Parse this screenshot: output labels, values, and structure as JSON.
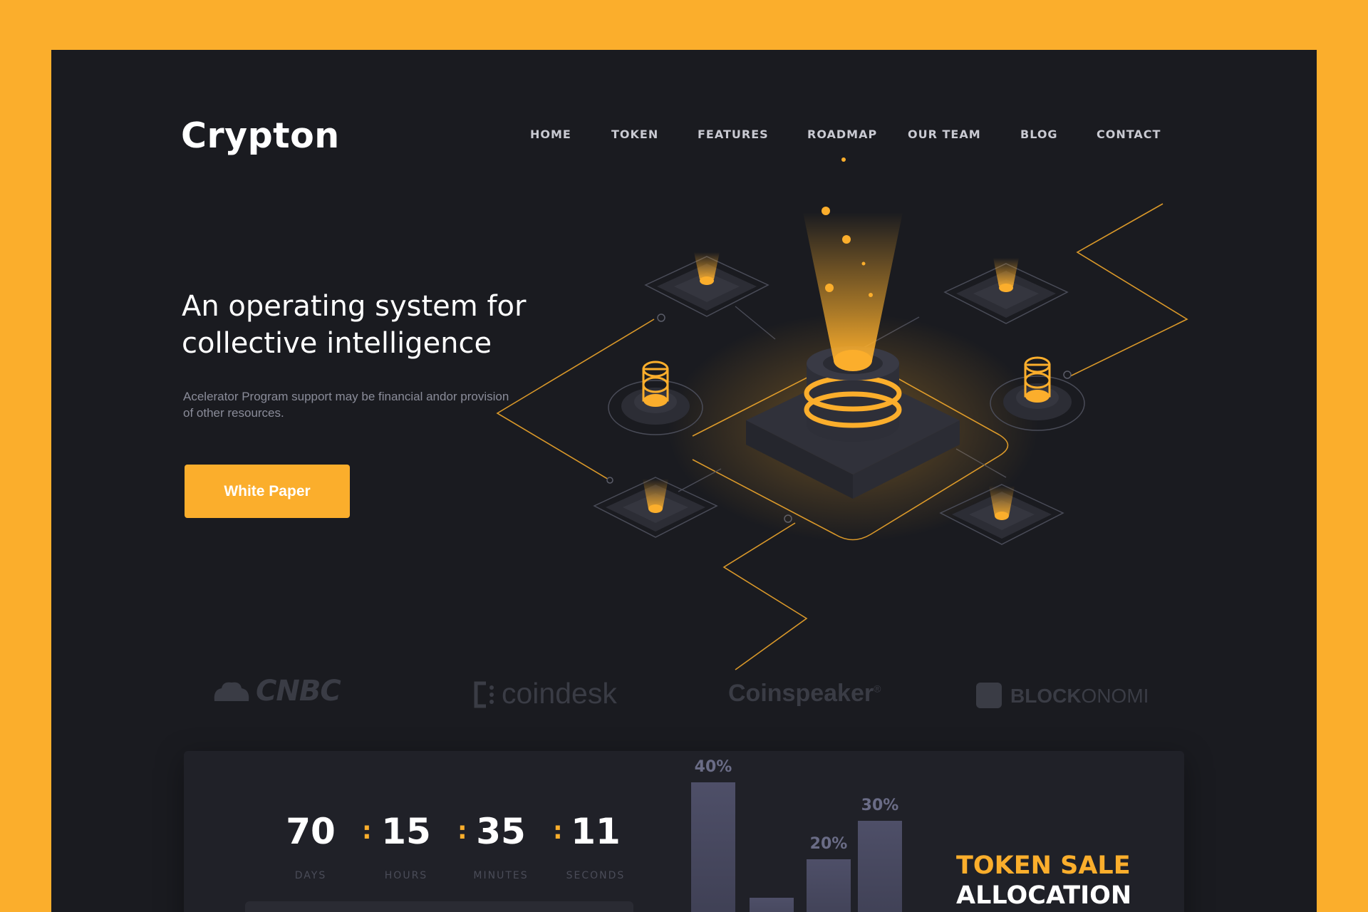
{
  "brand": {
    "name": "Crypton"
  },
  "nav": {
    "items": [
      "HOME",
      "TOKEN",
      "FEATURES",
      "ROADMAP",
      "OUR TEAM",
      "BLOG",
      "CONTACT"
    ],
    "active": "ROADMAP"
  },
  "hero": {
    "headline_line1": "An operating system for",
    "headline_line2": "collective intelligence",
    "subtext": "Acelerator Program support may be financial andor provision of other resources.",
    "cta_label": "White Paper"
  },
  "partners": {
    "cnbc": "CNBC",
    "coindesk": "coindesk",
    "coinspeaker": "Coinspeaker",
    "coinspeaker_mark": "®",
    "blockonomi_bold": "BLOCK",
    "blockonomi_thin": "ONOMI"
  },
  "countdown": {
    "days": "70",
    "hours": "15",
    "minutes": "35",
    "seconds": "11",
    "separator": ":",
    "days_label": "DAYS",
    "hours_label": "HOURS",
    "minutes_label": "MINUTES",
    "seconds_label": "SECONDS"
  },
  "token_sale": {
    "title_line1": "TOKEN SALE",
    "title_line2": "ALLOCATION"
  },
  "chart_data": {
    "type": "bar",
    "categories": [
      "",
      "",
      "",
      ""
    ],
    "values": [
      40,
      10,
      20,
      30
    ],
    "labels": [
      "40%",
      "",
      "20%",
      "30%"
    ]
  },
  "colors": {
    "accent": "#FBAE2C",
    "background": "#1A1B20",
    "page": "#FBAE2C"
  }
}
